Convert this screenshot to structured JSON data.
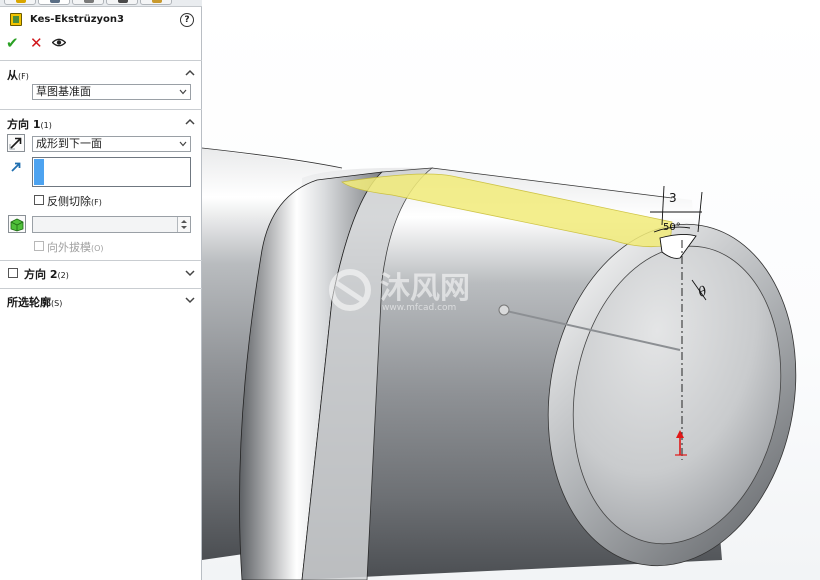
{
  "feature": {
    "title": "Kes-Ekstrüzyon3"
  },
  "icons": {
    "feature": "cut-extrude-icon",
    "help": "help-icon",
    "ok": "checkmark-icon",
    "cancel": "close-icon",
    "preview": "eye-icon",
    "direction1": "reverse-direction-icon",
    "selection": "arrow-select-icon",
    "draft": "draft-icon"
  },
  "actions": {
    "ok": "✔",
    "cancel": "✕",
    "help": "?"
  },
  "from": {
    "title": "从",
    "shortcut": "(F)",
    "value": "草图基准面"
  },
  "direction1": {
    "title": "方向 1",
    "shortcut": "(1)",
    "end_condition": "成形到下一面",
    "flip_side_label": "反侧切除",
    "flip_side_shortcut": "(F)",
    "draft_outward_label": "向外拔模",
    "draft_outward_shortcut": "(O)"
  },
  "direction2": {
    "title": "方向 2",
    "shortcut": "(2)"
  },
  "selected_contours": {
    "title": "所选轮廓",
    "shortcut": "(S)"
  },
  "viewport": {
    "dimension_1": "3",
    "dimension_2": "50°",
    "dimension_3": "θ",
    "watermark_cn": "沐风网",
    "watermark_url": "www.mfcad.com"
  },
  "colors": {
    "accent": "#4da3f0",
    "ok": "#2aa024",
    "cancel": "#d0161b",
    "face_highlight": "#f2ec7a",
    "axis_red": "#e01818"
  }
}
